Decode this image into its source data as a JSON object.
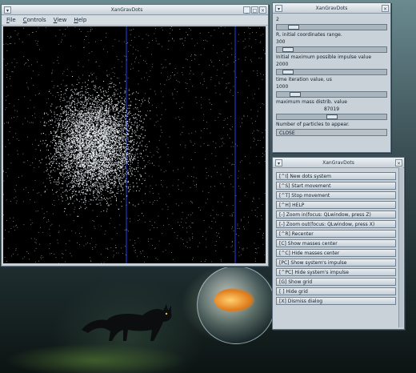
{
  "main_window": {
    "title": "XanGravDots",
    "menu": [
      "File",
      "Controls",
      "View",
      "Help"
    ]
  },
  "params_window": {
    "title": "XanGravDots",
    "items": [
      {
        "value": "2",
        "level": 0.1,
        "label": "R, initial coordinates range."
      },
      {
        "value": "300",
        "level": 0.05,
        "label": "Initial maximum possible impulse value"
      },
      {
        "value": "2000",
        "level": 0.05,
        "label": "time iteration value, us"
      },
      {
        "value": "1000",
        "level": 0.12,
        "label": "maximum mass distrib. value"
      },
      {
        "value": "87019",
        "level": 0.45,
        "label": "Number of particles to appear."
      }
    ],
    "close_label": "CLOSE"
  },
  "controls_window": {
    "title": "XanGravDots",
    "buttons": [
      "[^I] New dots system",
      "[^S] Start movement",
      "[^T] Stop movement",
      "[^H] HELP",
      "[-] Zoom in(focus: QLwindow, press  Z)",
      "[-] Zoom out(focus: QLwindow, press  X)",
      "[^R] Recenter",
      "[C] Show masses center",
      "[^C] Hide masses center",
      "[PC] Show system's impulse",
      "[^PC] Hide system's impulse",
      "[G] Show grid",
      "[ ] Hide grid",
      "[X] Dismiss dialog"
    ]
  },
  "window_buttons": {
    "minimize": "_",
    "maximize": "□",
    "close": "×",
    "menu": "▾"
  },
  "colors": {
    "canvas": "#000000",
    "grid": "#1a2aa0",
    "particle": "#e8eef2",
    "window": "#c9d2d8"
  }
}
